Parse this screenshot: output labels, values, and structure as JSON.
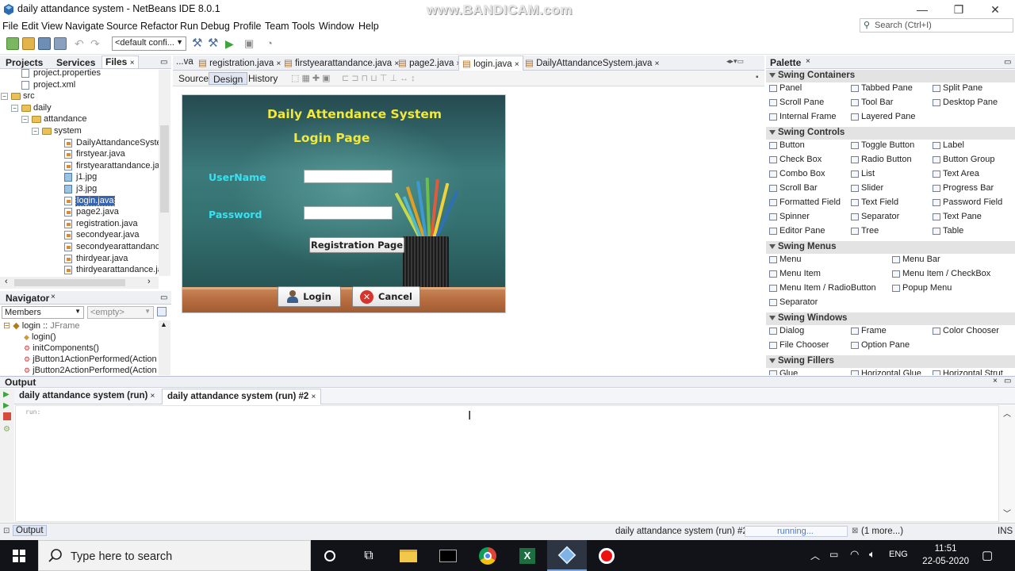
{
  "window": {
    "title": "daily attandance system - NetBeans IDE 8.0.1",
    "watermark": "www.BANDICAM.com"
  },
  "menu": [
    "File",
    "Edit",
    "View",
    "Navigate",
    "Source",
    "Refactor",
    "Run",
    "Debug",
    "Profile",
    "Team",
    "Tools",
    "Window",
    "Help"
  ],
  "search": {
    "placeholder": "Search (Ctrl+I)"
  },
  "toolbar": {
    "config": "<default confi..."
  },
  "projects_panel": {
    "tabs": [
      "Projects",
      "Services",
      "Files"
    ],
    "tree": [
      {
        "label": "project.properties",
        "indent": 1,
        "icon": "file"
      },
      {
        "label": "project.xml",
        "indent": 1,
        "icon": "xml"
      },
      {
        "label": "src",
        "indent": 0,
        "icon": "folder"
      },
      {
        "label": "daily",
        "indent": 1,
        "icon": "folder"
      },
      {
        "label": "attandance",
        "indent": 2,
        "icon": "folder"
      },
      {
        "label": "system",
        "indent": 3,
        "icon": "folder"
      },
      {
        "label": "DailyAttandanceSyster",
        "indent": 4,
        "icon": "java"
      },
      {
        "label": "firstyear.java",
        "indent": 4,
        "icon": "java"
      },
      {
        "label": "firstyearattandance.jav",
        "indent": 4,
        "icon": "java"
      },
      {
        "label": "j1.jpg",
        "indent": 4,
        "icon": "image"
      },
      {
        "label": "j3.jpg",
        "indent": 4,
        "icon": "image"
      },
      {
        "label": "login.java",
        "indent": 4,
        "icon": "java",
        "selected": true
      },
      {
        "label": "page2.java",
        "indent": 4,
        "icon": "java"
      },
      {
        "label": "registration.java",
        "indent": 4,
        "icon": "java"
      },
      {
        "label": "secondyear.java",
        "indent": 4,
        "icon": "java"
      },
      {
        "label": "secondyearattandance",
        "indent": 4,
        "icon": "java"
      },
      {
        "label": "thirdyear.java",
        "indent": 4,
        "icon": "java"
      },
      {
        "label": "thirdyearattandance.ja",
        "indent": 4,
        "icon": "java"
      }
    ]
  },
  "navigator": {
    "title": "Navigator",
    "members": "Members",
    "filter": "<empty>",
    "root_name": "login :: ",
    "root_type": "JFrame",
    "items": [
      "login()",
      "initComponents()",
      "jButton1ActionPerformed(Action",
      "jButton2ActionPerformed(Action"
    ]
  },
  "editor": {
    "tabs": [
      "...va",
      "registration.java",
      "firstyearattandance.java",
      "page2.java",
      "login.java",
      "DailyAttandanceSystem.java"
    ],
    "active_tab": "login.java",
    "views": [
      "Source",
      "Design",
      "History"
    ]
  },
  "form": {
    "title": "Daily Attendance System",
    "subtitle": "Login Page",
    "username_label": "UserName",
    "password_label": "Password",
    "registration_button": "Registration Page",
    "login_button": "Login",
    "cancel_button": "Cancel"
  },
  "palette": {
    "title": "Palette",
    "categories": [
      {
        "name": "Swing Containers",
        "items": [
          "Panel",
          "Tabbed Pane",
          "Split Pane",
          "Scroll Pane",
          "Tool Bar",
          "Desktop Pane",
          "Internal Frame",
          "Layered Pane"
        ]
      },
      {
        "name": "Swing Controls",
        "items": [
          "Button",
          "Toggle Button",
          "Label",
          "Check Box",
          "Radio Button",
          "Button Group",
          "Combo Box",
          "List",
          "Text Area",
          "Scroll Bar",
          "Slider",
          "Progress Bar",
          "Formatted Field",
          "Text Field",
          "Password Field",
          "Spinner",
          "Separator",
          "Text Pane",
          "Editor Pane",
          "Tree",
          "Table"
        ]
      },
      {
        "name": "Swing Menus",
        "items": [
          "Menu",
          "Menu Bar",
          "Menu Item",
          "Menu Item / CheckBox",
          "Menu Item / RadioButton",
          "Popup Menu",
          "Separator"
        ]
      },
      {
        "name": "Swing Windows",
        "items": [
          "Dialog",
          "Frame",
          "Color Chooser",
          "File Chooser",
          "Option Pane"
        ]
      },
      {
        "name": "Swing Fillers",
        "items": [
          "Glue",
          "Horizontal Glue",
          "Horizontal Strut"
        ]
      }
    ]
  },
  "output": {
    "title": "Output",
    "tabs": [
      "daily attandance system (run)",
      "daily attandance system (run) #2"
    ],
    "text": "run:"
  },
  "status": {
    "output_tab": "Output",
    "task": "daily attandance system (run) #2",
    "progress": "running...",
    "more": "(1 more...)",
    "mode": "INS"
  },
  "taskbar": {
    "search_placeholder": "Type here to search",
    "lang": "ENG",
    "time": "11:51",
    "date": "22-05-2020"
  }
}
